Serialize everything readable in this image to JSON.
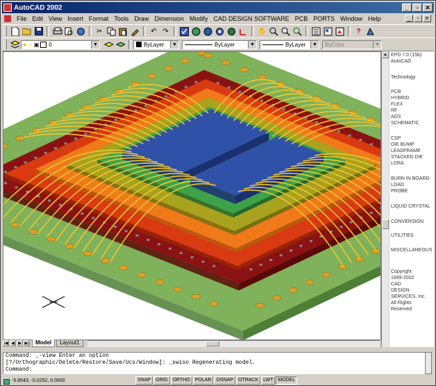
{
  "window": {
    "title": "AutoCAD 2002",
    "controls": {
      "minimize": "_",
      "restore": "▫",
      "close": "✕"
    }
  },
  "menu": {
    "items": [
      "File",
      "Edit",
      "View",
      "Insert",
      "Format",
      "Tools",
      "Draw",
      "Dimension",
      "Modify",
      "CAD DESIGN SOFTWARE",
      "PCB",
      "PORTS",
      "Window",
      "Help"
    ]
  },
  "layer_toolbar": {
    "layer_value": "0",
    "color_value": "ByLayer",
    "linetype_value": "ByLayer",
    "lineweight_value": "ByLayer",
    "plotstyle_value": "ByColor"
  },
  "side_panel": {
    "items": [
      "EPD 7.0 (15b)",
      "AutoCAD",
      "Technology",
      "PCB",
      "HYBRID",
      "FLEX",
      "RF",
      "ADS",
      "SCHEMATIC",
      "CSP",
      "DIE BUMP",
      "LEADFRAME",
      "STACKED DIE",
      "LDRA",
      "BURN IN BOARD",
      "LOAD",
      "PROBE",
      "LIQUID CRYSTAL",
      "CONVERSION",
      "UTILITIES",
      "MISCELLANEOUS",
      "Copyright",
      "1999-2002",
      "CAD",
      "DESIGN",
      "SERVICES, Inc.",
      "All Rights",
      "Reserved"
    ]
  },
  "layout_tabs": {
    "items": [
      "Model",
      "Layout1"
    ],
    "active": "Model"
  },
  "command_line": {
    "lines": [
      "Command: _-view Enter an option",
      "[?/Orthographic/Delete/Restore/Save/Ucs/Window]: _swiso Regenerating model.",
      "Command:"
    ]
  },
  "status_bar": {
    "coordinates": "-5.8543, -0.0252, 0.0000",
    "toggles": [
      "SNAP",
      "GRID",
      "ORTHO",
      "POLAR",
      "OSNAP",
      "OTRACK",
      "LWT",
      "MODEL"
    ]
  },
  "colors": {
    "board": "#7fb25a",
    "board_edge": "#4e7f36",
    "ring_dark_red": "#8b1212",
    "ring_red": "#d93a12",
    "ring_orange": "#f07a1a",
    "ring_olive": "#a8a21e",
    "ring_green": "#3ea24a",
    "die": "#2f52a8",
    "wire": "#f2c530",
    "title_start": "#0a246a",
    "title_end": "#3a6ea5"
  }
}
